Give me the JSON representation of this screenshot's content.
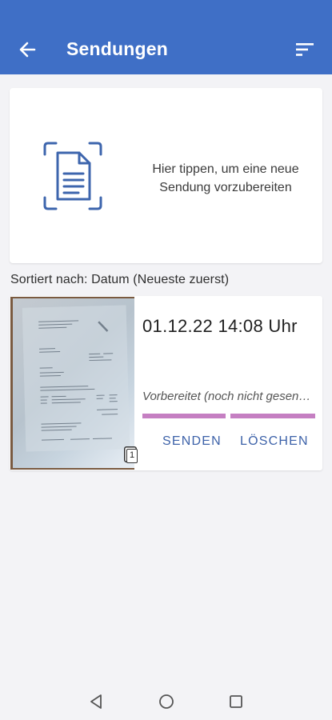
{
  "app_bar": {
    "title": "Sendungen",
    "back_icon": "arrow-left-icon",
    "sort_icon": "sort-icon",
    "color": "#3f6fc6"
  },
  "new_shipment": {
    "text_line1": "Hier tippen, um eine neue",
    "text_line2": "Sendung vorzubereiten",
    "icon": "document-scan-icon"
  },
  "sort": {
    "label": "Sortiert nach: Datum (Neueste zuerst)"
  },
  "shipments": [
    {
      "date": "01.12.22 14:08 Uhr",
      "status": "Vorbereitet (noch nicht gesendet)",
      "page_count": "1",
      "progress_color": "#c57fc2",
      "send_label": "SENDEN",
      "delete_label": "LÖSCHEN"
    }
  ],
  "system_nav": {
    "back_icon": "triangle-back-icon",
    "home_icon": "circle-home-icon",
    "recent_icon": "square-recent-icon"
  }
}
